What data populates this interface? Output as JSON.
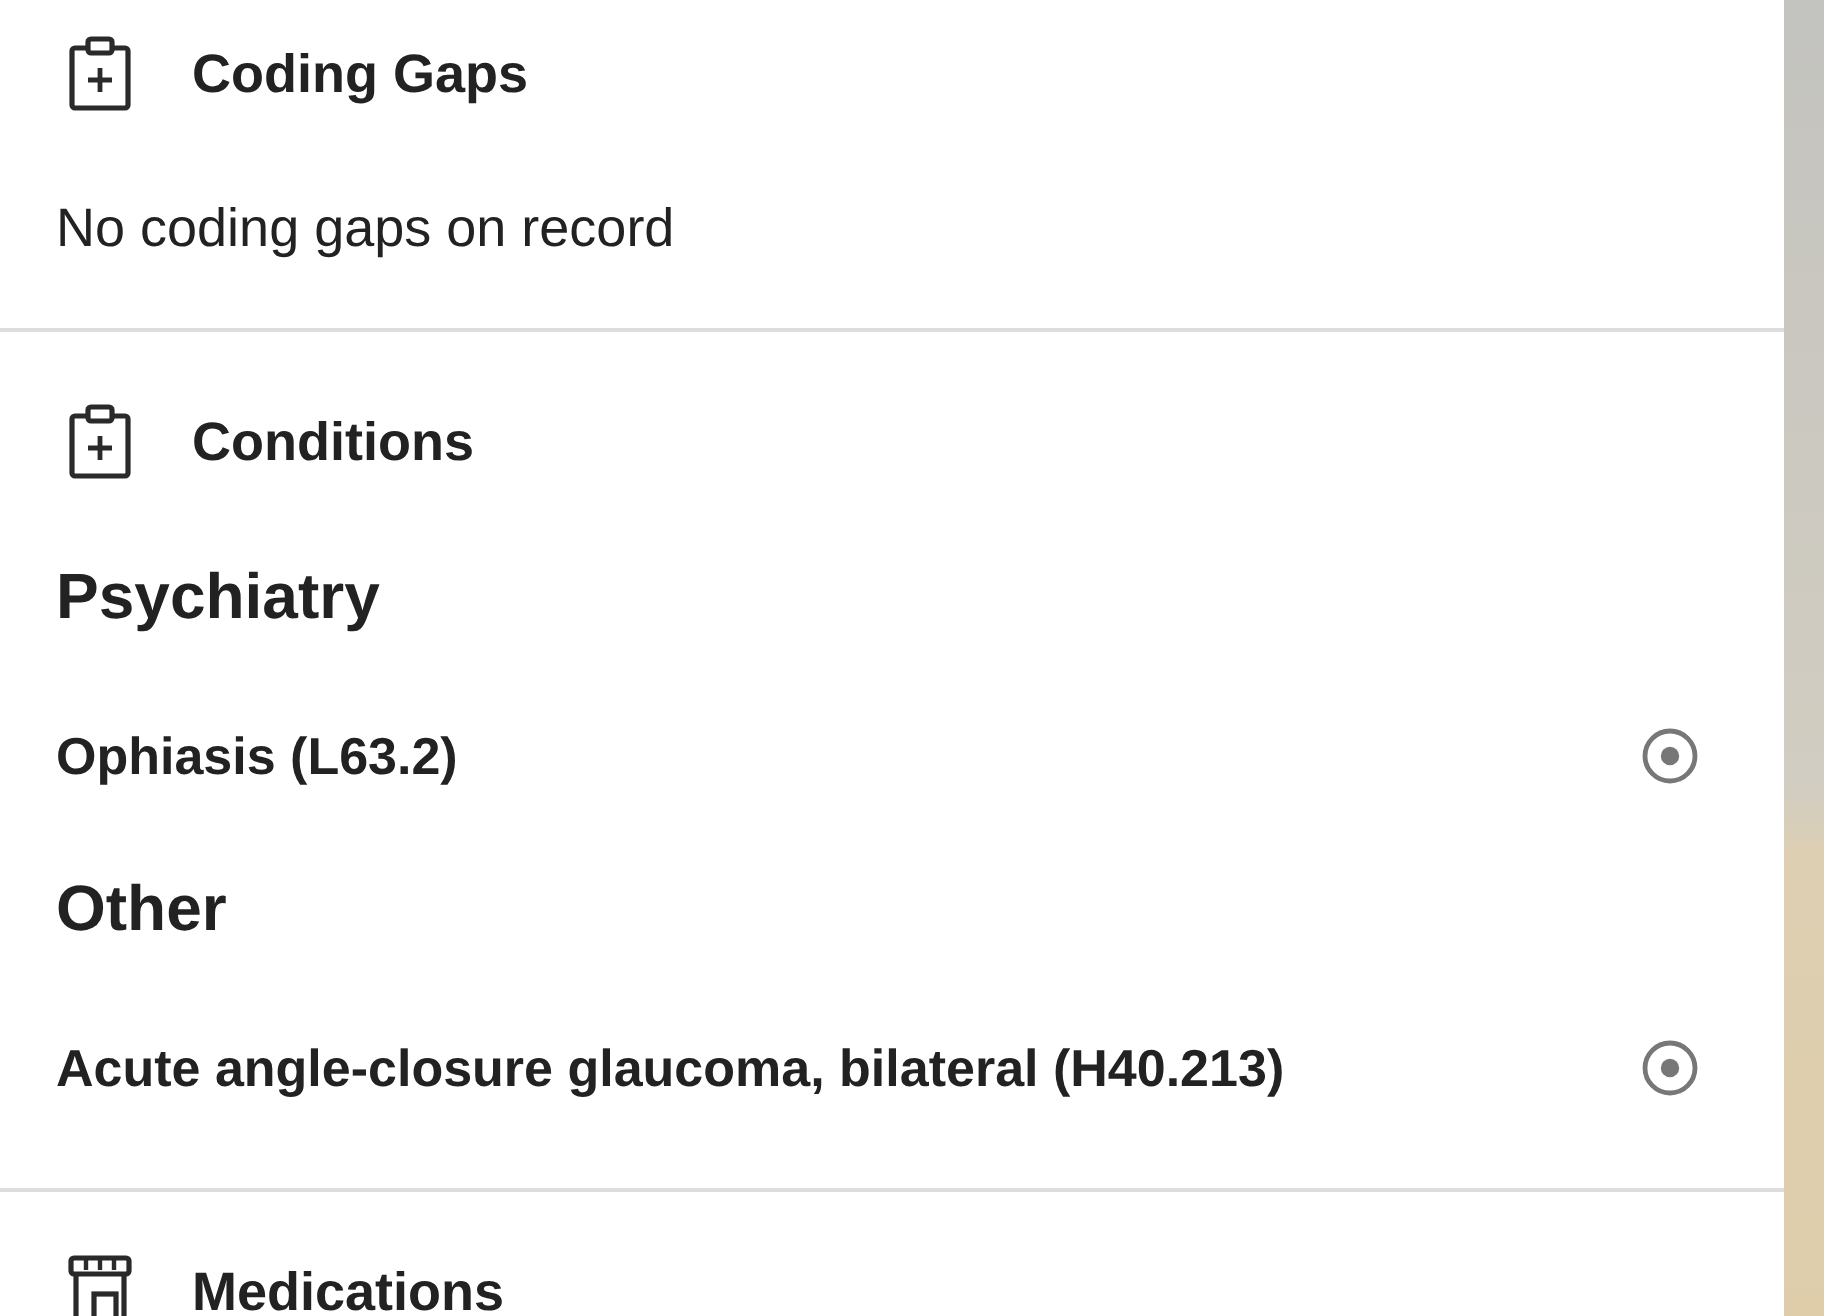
{
  "sections": [
    {
      "kind": "clipboard",
      "title": "Coding Gaps",
      "empty_text": "No coding gaps on record"
    },
    {
      "kind": "clipboard",
      "title": "Conditions",
      "groups": [
        {
          "heading": "Psychiatry",
          "items": [
            {
              "name": "Ophiasis (L63.2)"
            }
          ]
        },
        {
          "heading": "Other",
          "items": [
            {
              "name": "Acute angle-closure glaucoma, bilateral (H40.213)"
            }
          ]
        }
      ]
    },
    {
      "kind": "store",
      "title": "Medications"
    }
  ]
}
